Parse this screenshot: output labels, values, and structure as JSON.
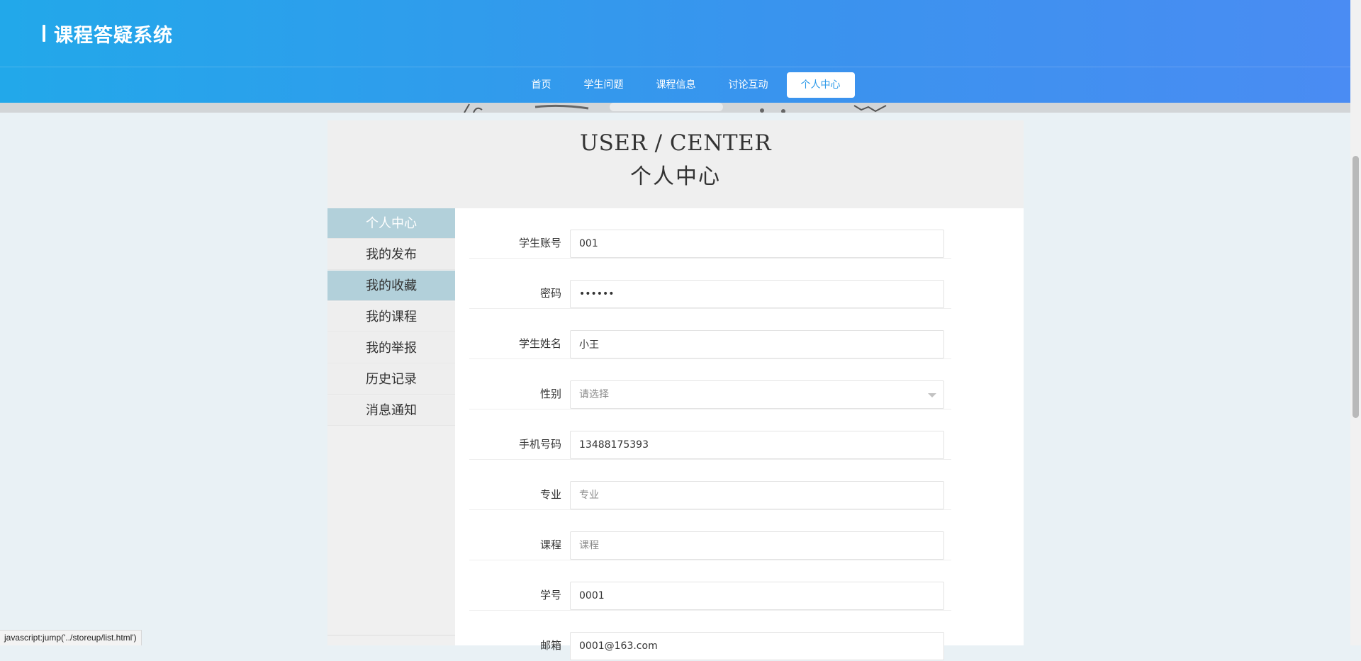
{
  "header": {
    "title": "课程答疑系统"
  },
  "nav": {
    "items": [
      {
        "label": "首页"
      },
      {
        "label": "学生问题"
      },
      {
        "label": "课程信息"
      },
      {
        "label": "讨论互动"
      },
      {
        "label": "个人中心"
      }
    ]
  },
  "page_title": {
    "english": "USER / CENTER",
    "chinese": "个人中心"
  },
  "sidebar": {
    "items": [
      {
        "label": "个人中心"
      },
      {
        "label": "我的发布"
      },
      {
        "label": "我的收藏"
      },
      {
        "label": "我的课程"
      },
      {
        "label": "我的举报"
      },
      {
        "label": "历史记录"
      },
      {
        "label": "消息通知"
      }
    ]
  },
  "form": {
    "account": {
      "label": "学生账号",
      "value": "001"
    },
    "password": {
      "label": "密码",
      "value": "••••••"
    },
    "name": {
      "label": "学生姓名",
      "value": "小王"
    },
    "gender": {
      "label": "性别",
      "selected": "请选择"
    },
    "phone": {
      "label": "手机号码",
      "value": "13488175393"
    },
    "major": {
      "label": "专业",
      "placeholder": "专业"
    },
    "course": {
      "label": "课程",
      "placeholder": "课程"
    },
    "student_no": {
      "label": "学号",
      "value": "0001"
    },
    "email": {
      "label": "邮箱",
      "value": "0001@163.com"
    }
  },
  "status_bar": {
    "text": "javascript:jump('../storeup/list.html')"
  },
  "colors": {
    "header_start": "#22a8ea",
    "header_end": "#4a8cf3",
    "sidebar_active": "#b2d0da",
    "page_bg": "#e9f1f5"
  }
}
